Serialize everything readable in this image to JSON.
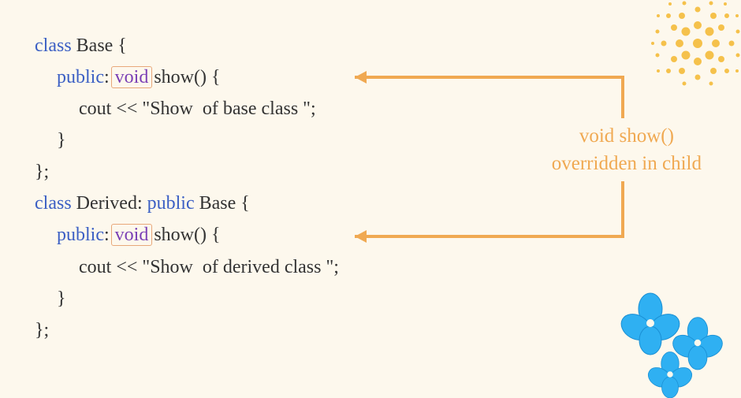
{
  "code": {
    "l1": {
      "kw_class": "class",
      "name": " Base {"
    },
    "l2": {
      "kw_public": "public",
      "colon": ": ",
      "kw_void": "void",
      "fn": " show() {"
    },
    "l3": "cout << \"Show  of base class \";",
    "l4": "}",
    "l5": "};",
    "l6": {
      "kw_class": "class",
      "name": " Derived: ",
      "kw_public": "public",
      "base": " Base {"
    },
    "l7": {
      "kw_public": "public",
      "colon": ": ",
      "kw_void": "void",
      "fn": " show() {"
    },
    "l8": "cout << \"Show  of derived class \";",
    "l9": "}",
    "l10": "};"
  },
  "annotation": {
    "line1": "void show()",
    "line2": "overridden in child"
  },
  "colors": {
    "arrow": "#f0a952",
    "dots": "#f5c14b",
    "flower": "#2fb0f2"
  }
}
